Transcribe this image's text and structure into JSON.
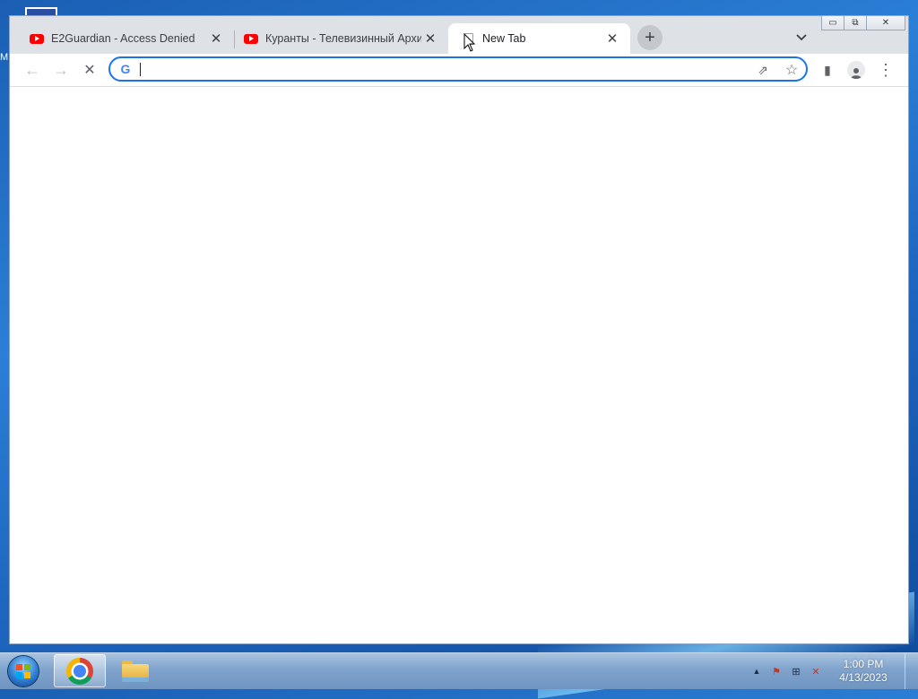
{
  "desktop": {
    "edge_label": "M"
  },
  "browser": {
    "tabs": [
      {
        "title": "E2Guardian - Access Denied",
        "favicon": "youtube-icon",
        "active": false
      },
      {
        "title": "Куранты - Телевизинный Архив",
        "favicon": "youtube-icon",
        "active": false
      },
      {
        "title": "New Tab",
        "favicon": "blank-page-icon",
        "active": true
      }
    ],
    "new_tab_label": "+",
    "tab_search_icon": "chevron-down-icon",
    "window_controls": {
      "minimize": "▭",
      "restore": "⧉",
      "close": "✕"
    },
    "toolbar": {
      "back_icon": "←",
      "forward_icon": "→",
      "stop_icon": "✕",
      "omnibox_value": "",
      "search_provider_icon": "G",
      "share_icon": "⇗",
      "bookmark_icon": "☆",
      "side_panel_icon": "▮",
      "profile_icon": "●",
      "menu_icon": "⋮"
    }
  },
  "taskbar": {
    "apps": [
      {
        "name": "Google Chrome",
        "active": true
      },
      {
        "name": "Windows Explorer",
        "active": false
      }
    ],
    "tray": {
      "show_hidden": "▲",
      "action_center": "⚑",
      "network": "⊞",
      "volume": "✕"
    },
    "clock": {
      "time": "1:00 PM",
      "date": "4/13/2023"
    }
  }
}
